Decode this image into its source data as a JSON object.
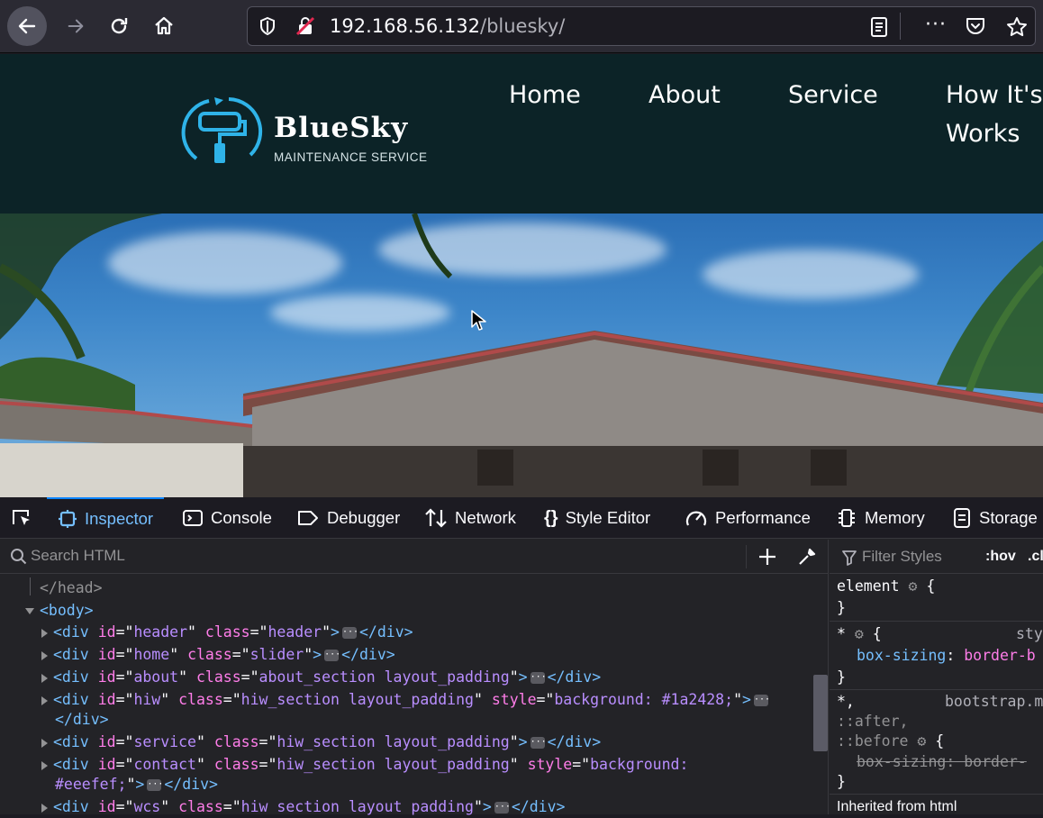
{
  "browser": {
    "url_host": "192.168.56.132",
    "url_path": "/bluesky/"
  },
  "site": {
    "brand_name": "BlueSky",
    "brand_tagline": "MAINTENANCE SERVICE",
    "nav": [
      "Home",
      "About",
      "Service",
      "How It's Works"
    ]
  },
  "devtools": {
    "tabs": [
      "Inspector",
      "Console",
      "Debugger",
      "Network",
      "Style Editor",
      "Performance",
      "Memory",
      "Storage"
    ],
    "active_tab": "Inspector",
    "search_placeholder": "Search HTML",
    "filter_placeholder": "Filter Styles",
    "filter_pseudo": ":hov",
    "filter_cls": ".cl",
    "tree": {
      "head_close": "</head>",
      "body_open": "<body>",
      "nodes": [
        {
          "id": "header",
          "class": "header",
          "style": ""
        },
        {
          "id": "home",
          "class": "slider",
          "style": ""
        },
        {
          "id": "about",
          "class": "about_section layout_padding",
          "style": ""
        },
        {
          "id": "hiw",
          "class": "hiw_section layout_padding",
          "style": "background: #1a2428;"
        },
        {
          "id": "service",
          "class": "hiw_section layout_padding",
          "style": ""
        },
        {
          "id": "contact",
          "class": "hiw_section layout_padding",
          "style": "background:"
        },
        {
          "id": "wcs",
          "class": "hiw section layout padding",
          "style": ""
        }
      ],
      "contact_style_cont": "#eeefef;",
      "close_div": "</div>"
    },
    "rules": {
      "element_selector": "element",
      "universal_selector": "*",
      "universal_source": "sty",
      "universal_prop": "box-sizing",
      "universal_val": "border-b",
      "multi_selector_1": "*,",
      "multi_source": "bootstrap.m",
      "multi_selector_2": "::after,",
      "multi_selector_3": "::before",
      "multi_prop_struck": "box-sizing: border-",
      "inherited_label": "Inherited from html"
    }
  },
  "colors": {
    "site_header_bg": "#0c2327",
    "logo_accent": "#2fb3e8",
    "devtools_active": "#75bfff"
  }
}
